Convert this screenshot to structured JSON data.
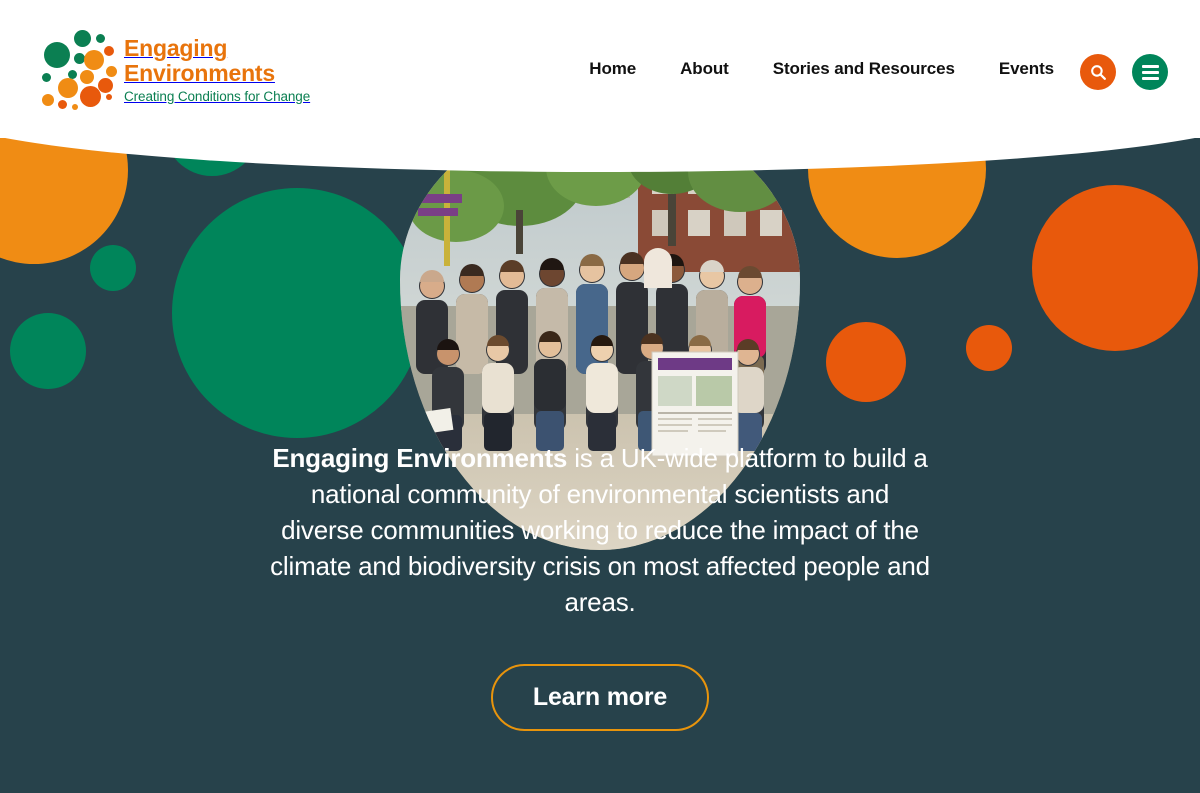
{
  "site": {
    "logo": {
      "line1": "Engaging",
      "line2": "Environments",
      "tagline": "Creating Conditions for Change",
      "brand_orange": "#E8740C",
      "brand_green": "#0B7F52"
    }
  },
  "header": {
    "nav": [
      {
        "label": "Home"
      },
      {
        "label": "About"
      },
      {
        "label": "Stories and Resources"
      },
      {
        "label": "Events"
      }
    ],
    "search_button": {
      "icon": "search-icon",
      "color": "#E8590C"
    },
    "menu_button": {
      "icon": "hamburger-menu-icon",
      "color": "#00855A"
    }
  },
  "hero": {
    "background_color": "#27424B",
    "photo_alt": "Group photo of Engaging Environments community members outdoors",
    "lede_bold": "Engaging Environments",
    "lede_rest": " is a UK-wide platform to build a national community of environmental scientists and diverse communities working to reduce the impact of the climate and biodiversity crisis on most affected people and areas.",
    "cta_label": "Learn more",
    "cta_border_color": "#E8940C",
    "decor_colors": {
      "green": "#00855A",
      "orange_light": "#F08C14",
      "orange_dark": "#E85A10"
    }
  }
}
